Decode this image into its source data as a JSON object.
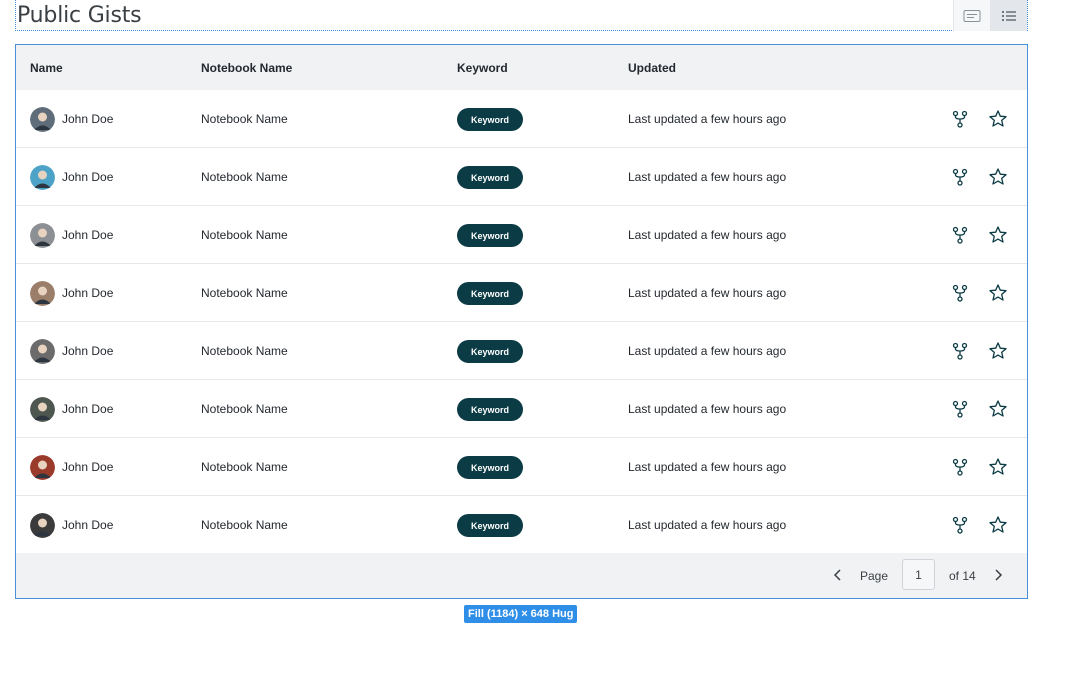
{
  "header": {
    "title": "Public Gists"
  },
  "view_toggle": [
    {
      "icon": "card-view-icon"
    },
    {
      "icon": "list-view-icon",
      "active": true
    }
  ],
  "table": {
    "columns": {
      "name": "Name",
      "notebook": "Notebook Name",
      "keyword": "Keyword",
      "updated": "Updated"
    },
    "rows": [
      {
        "name": "John Doe",
        "notebook": "Notebook Name",
        "keyword": "Keyword",
        "updated": "Last updated a few hours ago",
        "avatar_color": "#5f6d7a"
      },
      {
        "name": "John Doe",
        "notebook": "Notebook Name",
        "keyword": "Keyword",
        "updated": "Last updated a few hours ago",
        "avatar_color": "#4da3c7"
      },
      {
        "name": "John Doe",
        "notebook": "Notebook Name",
        "keyword": "Keyword",
        "updated": "Last updated a few hours ago",
        "avatar_color": "#8c8f93"
      },
      {
        "name": "John Doe",
        "notebook": "Notebook Name",
        "keyword": "Keyword",
        "updated": "Last updated a few hours ago",
        "avatar_color": "#9a7e6a"
      },
      {
        "name": "John Doe",
        "notebook": "Notebook Name",
        "keyword": "Keyword",
        "updated": "Last updated a few hours ago",
        "avatar_color": "#6b6b6b"
      },
      {
        "name": "John Doe",
        "notebook": "Notebook Name",
        "keyword": "Keyword",
        "updated": "Last updated a few hours ago",
        "avatar_color": "#4e5650"
      },
      {
        "name": "John Doe",
        "notebook": "Notebook Name",
        "keyword": "Keyword",
        "updated": "Last updated a few hours ago",
        "avatar_color": "#9a3a2a"
      },
      {
        "name": "John Doe",
        "notebook": "Notebook Name",
        "keyword": "Keyword",
        "updated": "Last updated a few hours ago",
        "avatar_color": "#3b3b3b"
      }
    ]
  },
  "pagination": {
    "page_label": "Page",
    "current_page": "1",
    "of_label": "of 14"
  },
  "size_tag": "Fill (1184) × 648 Hug",
  "colors": {
    "accent": "#0b3b44",
    "selection": "#4a90d9"
  }
}
